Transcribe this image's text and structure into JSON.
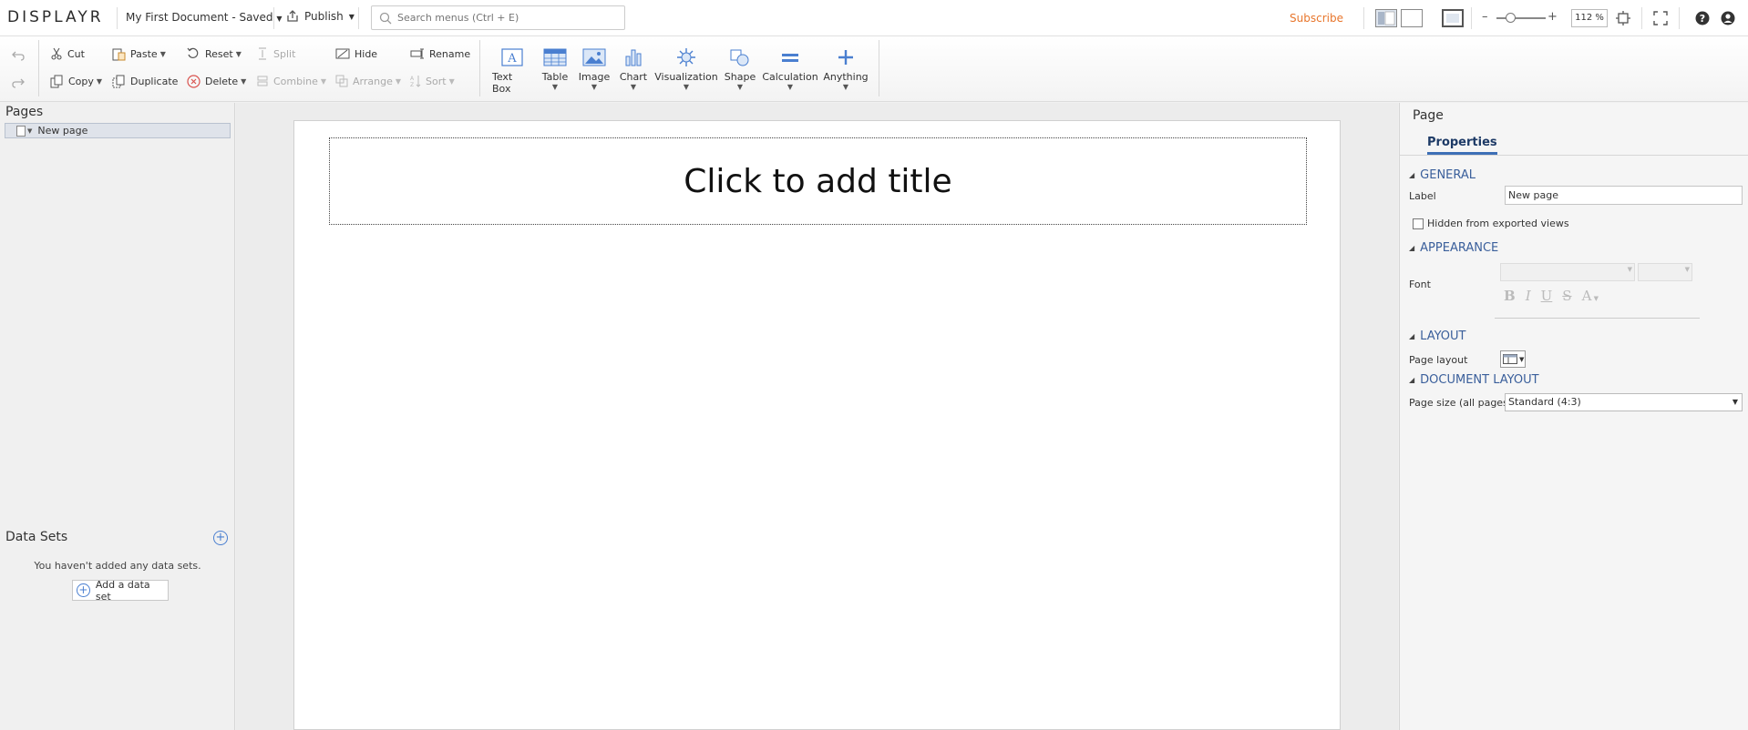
{
  "topbar": {
    "logo": "DISPLAYR",
    "doc_title": "My First Document - Saved",
    "publish": "Publish",
    "search_placeholder": "Search menus (Ctrl + E)",
    "subscribe": "Subscribe",
    "zoom": "112 %"
  },
  "ribbon": {
    "cut": "Cut",
    "copy": "Copy",
    "paste": "Paste",
    "duplicate": "Duplicate",
    "reset": "Reset",
    "delete": "Delete",
    "split": "Split",
    "combine": "Combine",
    "hide": "Hide",
    "arrange": "Arrange",
    "rename": "Rename",
    "sort": "Sort",
    "insert": {
      "text_box": "Text Box",
      "table": "Table",
      "image": "Image",
      "chart": "Chart",
      "visualization": "Visualization",
      "shape": "Shape",
      "calculation": "Calculation",
      "anything": "Anything"
    }
  },
  "left_panel": {
    "pages_title": "Pages",
    "pages": [
      "New page"
    ],
    "datasets_title": "Data Sets",
    "datasets_empty": "You haven't added any data sets.",
    "add_dataset": "Add a data set"
  },
  "canvas": {
    "title_placeholder": "Click to add title"
  },
  "right_panel": {
    "title": "Page",
    "tab": "Properties",
    "general": "GENERAL",
    "label_field": "Label",
    "label_value": "New page",
    "hidden_checkbox": "Hidden from exported views",
    "appearance": "APPEARANCE",
    "font_field": "Font",
    "layout": "LAYOUT",
    "page_layout_field": "Page layout",
    "document_layout": "DOCUMENT LAYOUT",
    "page_size_field": "Page size (all pages)",
    "page_size_value": "Standard (4:3)"
  },
  "colors": {
    "accent_blue": "#3d6fb6",
    "subscribe_orange": "#e8762c"
  }
}
